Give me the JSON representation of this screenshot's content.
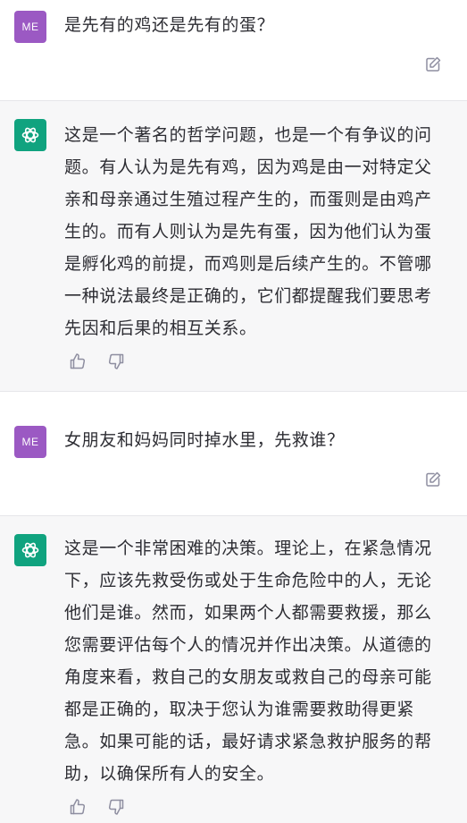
{
  "messages": [
    {
      "role": "user",
      "avatar_label": "ME",
      "text": "是先有的鸡还是先有的蛋？",
      "icons": [
        "edit-icon"
      ]
    },
    {
      "role": "assistant",
      "avatar_icon": "openai-logo-icon",
      "text": "这是一个著名的哲学问题，也是一个有争议的问题。有人认为是先有鸡，因为鸡是由一对特定父亲和母亲通过生殖过程产生的，而蛋则是由鸡产生的。而有人则认为是先有蛋，因为他们认为蛋是孵化鸡的前提，而鸡则是后续产生的。不管哪一种说法最终是正确的，它们都提醒我们要思考先因和后果的相互关系。",
      "icons": [
        "thumbs-up-icon",
        "thumbs-down-icon"
      ]
    },
    {
      "role": "user",
      "avatar_label": "ME",
      "text": "女朋友和妈妈同时掉水里，先救谁？",
      "icons": [
        "edit-icon"
      ]
    },
    {
      "role": "assistant",
      "avatar_icon": "openai-logo-icon",
      "text": "这是一个非常困难的决策。理论上，在紧急情况下，应该先救受伤或处于生命危险中的人，无论他们是谁。然而，如果两个人都需要救援，那么您需要评估每个人的情况并作出决策。从道德的角度来看，救自己的女朋友或救自己的母亲可能都是正确的，取决于您认为谁需要救助得更紧急。如果可能的话，最好请求紧急救护服务的帮助，以确保所有人的安全。",
      "icons": [
        "thumbs-up-icon",
        "thumbs-down-icon"
      ]
    }
  ],
  "colors": {
    "user_avatar": "#9b59c3",
    "assistant_avatar": "#10a37f",
    "assistant_bg": "#f7f7f8",
    "text": "#2d2d33",
    "icon": "#8e8ea0"
  }
}
